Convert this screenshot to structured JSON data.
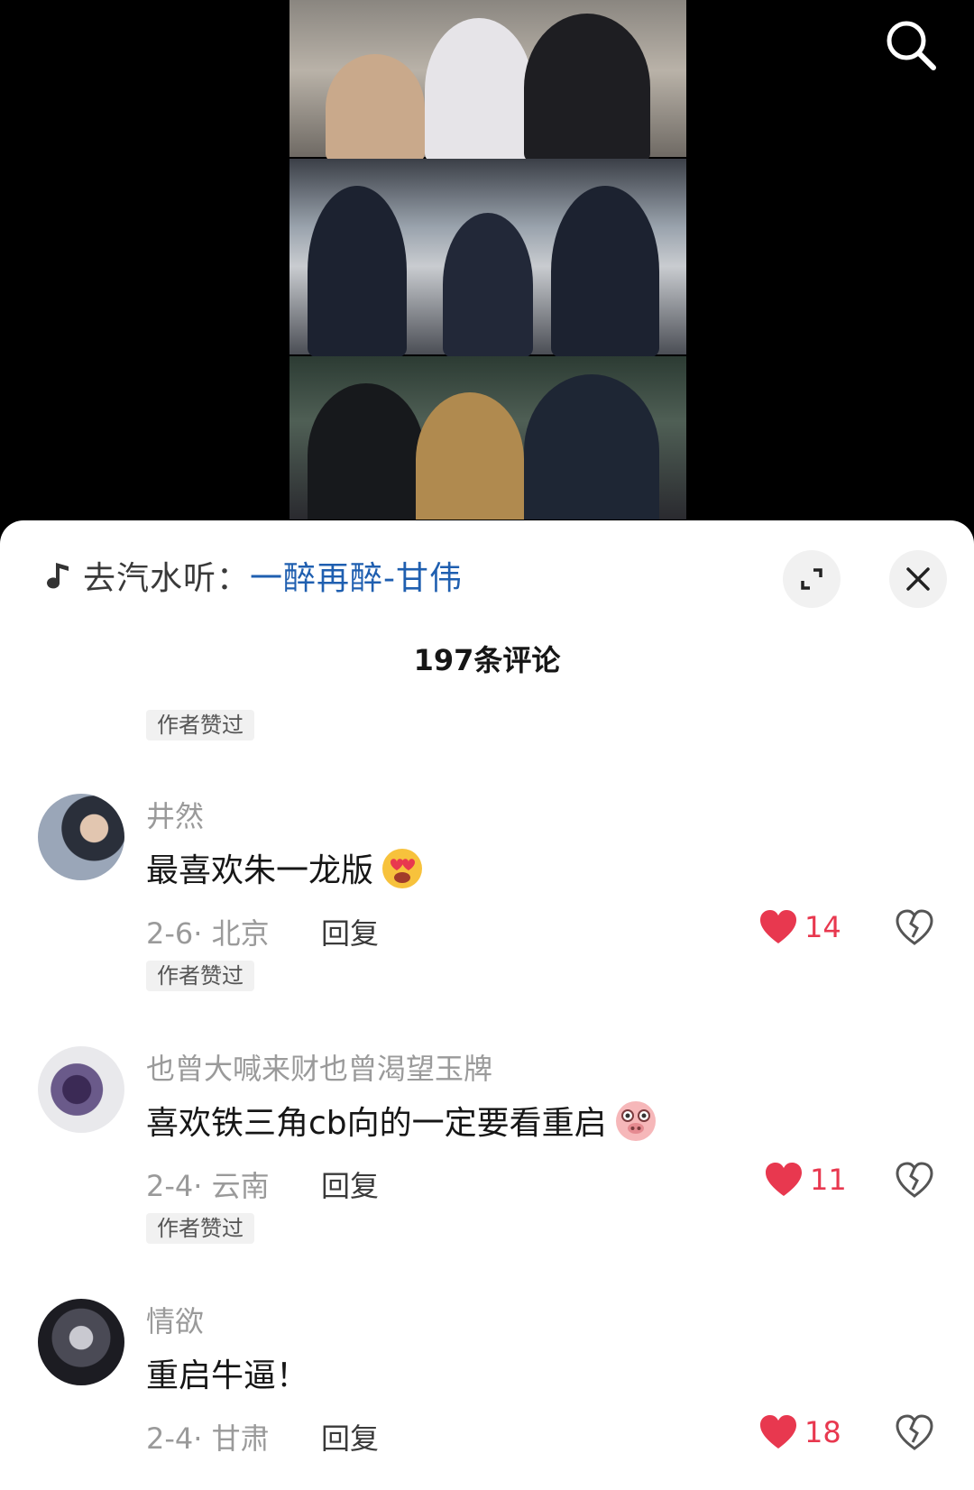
{
  "music": {
    "prefix": "去汽水听：",
    "title": "一醉再醉-甘伟"
  },
  "header": {
    "comment_count_label": "197条评论"
  },
  "top_author_tag": "作者赞过",
  "comments": [
    {
      "username": "井然",
      "text": "最喜欢朱一龙版",
      "emoji": "heart-eyes-emoji",
      "date_location": "2-6· 北京",
      "reply_label": "回复",
      "likes": "14",
      "author_tag": "作者赞过"
    },
    {
      "username": "也曾大喊来财也曾渴望玉牌",
      "text": "喜欢铁三角cb向的一定要看重启",
      "emoji": "pig-face-emoji",
      "date_location": "2-4· 云南",
      "reply_label": "回复",
      "likes": "11",
      "author_tag": "作者赞过"
    },
    {
      "username": "情欲",
      "text": "重启牛逼！",
      "date_location": "2-4· 甘肃",
      "reply_label": "回复",
      "likes": "18"
    }
  ],
  "colors": {
    "accent_like": "#e8384f",
    "music_link": "#1f5fb0",
    "secondary_text": "#9a9a9a"
  },
  "icons": [
    "search-icon",
    "music-note-icon",
    "expand-icon",
    "close-icon",
    "heart-icon",
    "broken-heart-icon"
  ]
}
